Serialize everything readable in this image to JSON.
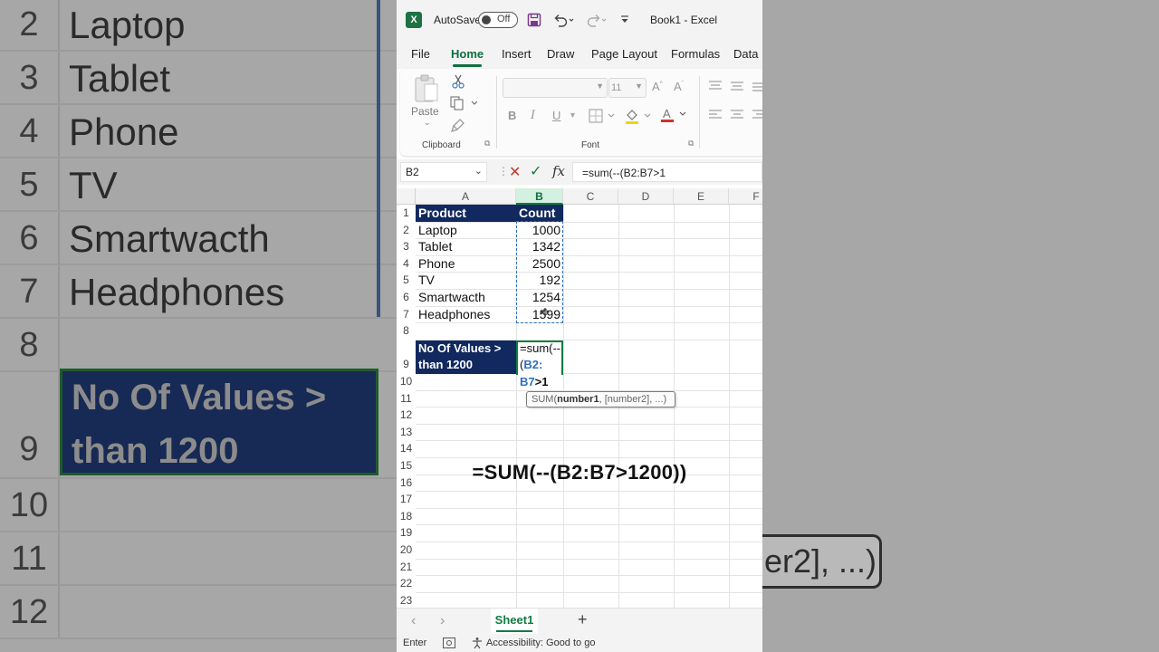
{
  "background": {
    "rows": [
      {
        "num": "2",
        "text": "Laptop"
      },
      {
        "num": "3",
        "text": "Tablet"
      },
      {
        "num": "4",
        "text": "Phone"
      },
      {
        "num": "5",
        "text": "TV"
      },
      {
        "num": "6",
        "text": "Smartwacth"
      },
      {
        "num": "7",
        "text": "Headphones"
      },
      {
        "num": "8",
        "text": ""
      }
    ],
    "navy_line1": "No Of Values >",
    "navy_line2": "than 1200",
    "row9": "9",
    "row10": "10",
    "row11": "11",
    "row12": "12",
    "right_tooltip": "er2], ...)"
  },
  "titlebar": {
    "app_icon": "excel-logo",
    "autosave_label": "AutoSave",
    "toggle_label": "Off",
    "save_icon": "save-icon",
    "undo_icon": "undo-icon",
    "redo_icon": "redo-icon",
    "customize_icon": "customize-qat-icon",
    "doc_title": "Book1  -  Excel"
  },
  "menu": {
    "tabs": [
      {
        "label": "File",
        "active": false
      },
      {
        "label": "Home",
        "active": true
      },
      {
        "label": "Insert",
        "active": false
      },
      {
        "label": "Draw",
        "active": false
      },
      {
        "label": "Page Layout",
        "active": false
      },
      {
        "label": "Formulas",
        "active": false
      },
      {
        "label": "Data",
        "active": false
      }
    ]
  },
  "ribbon": {
    "paste_label": "Paste",
    "clipboard_label": "Clipboard",
    "font_label": "Font",
    "font_size": "11",
    "bold": "B",
    "italic": "I",
    "underline": "U"
  },
  "formula_bar": {
    "name_box": "B2",
    "formula": "=sum(--(B2:B7>1"
  },
  "grid": {
    "columns": [
      "A",
      "B",
      "C",
      "D",
      "E",
      "F"
    ],
    "selected_column": "B",
    "row_numbers": [
      "1",
      "2",
      "3",
      "4",
      "5",
      "6",
      "7",
      "8",
      "9",
      "10",
      "11",
      "12",
      "13",
      "14",
      "15",
      "16",
      "17",
      "18",
      "19",
      "20",
      "21",
      "22",
      "23"
    ],
    "header": {
      "a": "Product",
      "b": "Count"
    },
    "rows": [
      {
        "product": "Laptop",
        "count": "1000"
      },
      {
        "product": "Tablet",
        "count": "1342"
      },
      {
        "product": "Phone",
        "count": "2500"
      },
      {
        "product": "TV",
        "count": "192"
      },
      {
        "product": "Smartwacth",
        "count": "1254"
      },
      {
        "product": "Headphones",
        "count": "1599"
      }
    ],
    "label_line1": "No Of Values >",
    "label_line2": "than 1200",
    "edit_line1": "=sum(--",
    "edit_line2a": "(",
    "edit_line2b": "B2:",
    "edit_line3a": "B7",
    "edit_line3b": ">1",
    "tooltip_fn": "SUM(",
    "tooltip_arg": "number1",
    "tooltip_rest": ", [number2], ...)",
    "overlay_formula": "=SUM(--(B2:B7>1200))"
  },
  "sheets": {
    "tabs": [
      "Sheet1"
    ],
    "add_label": "+"
  },
  "status": {
    "mode": "Enter",
    "accessibility": "Accessibility: Good to go"
  }
}
